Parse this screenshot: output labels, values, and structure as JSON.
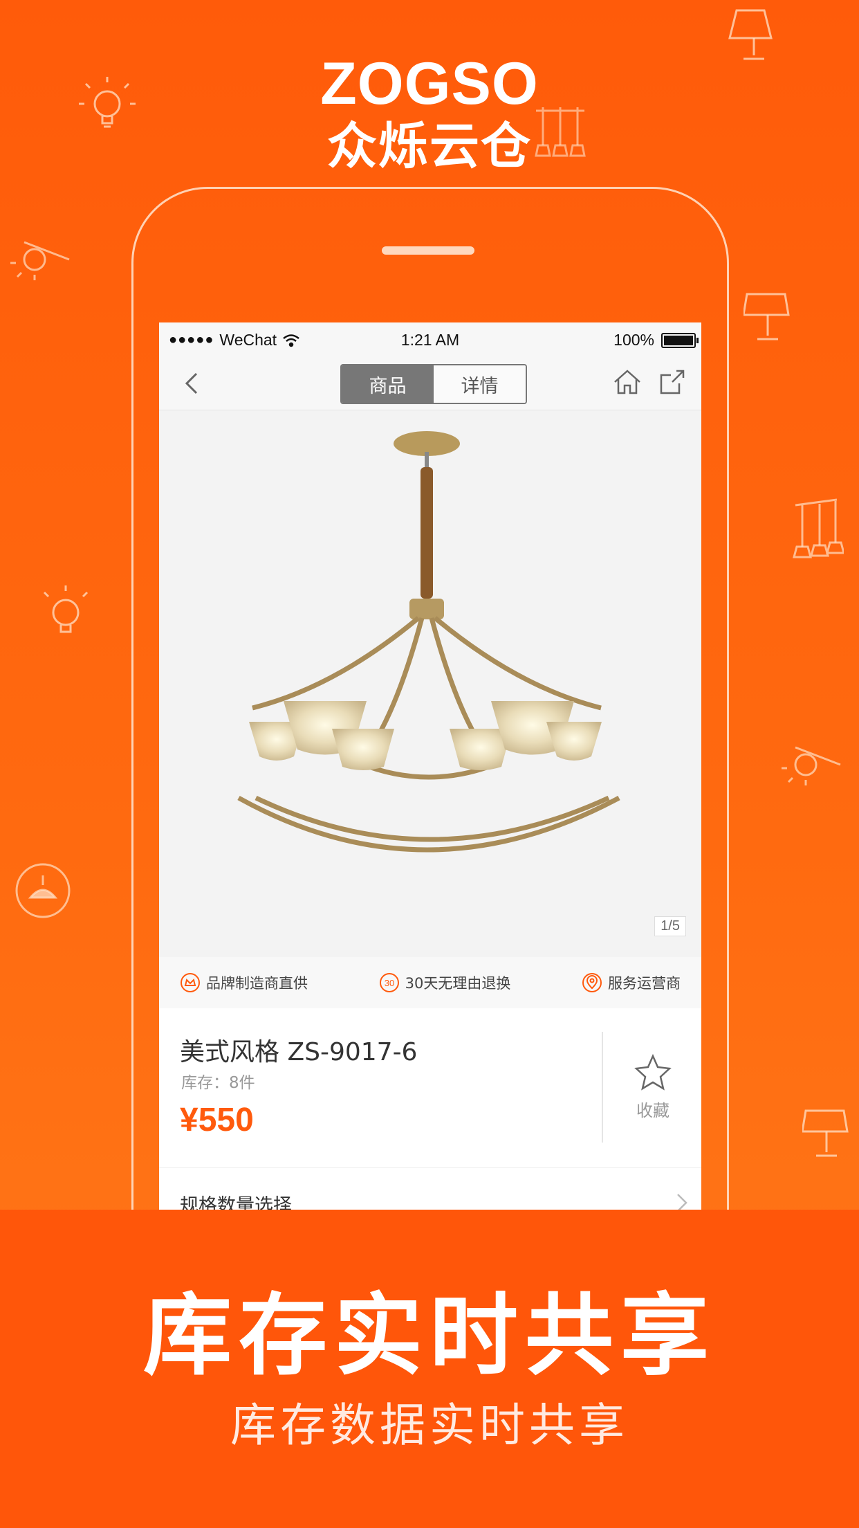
{
  "brand": {
    "name_en": "ZOGSO",
    "name_cn": "众烁云仓"
  },
  "status_bar": {
    "carrier": "WeChat",
    "time": "1:21 AM",
    "battery": "100%"
  },
  "nav": {
    "tabs": [
      {
        "label": "商品",
        "active": true
      },
      {
        "label": "详情",
        "active": false
      }
    ]
  },
  "product": {
    "image_pager": "1/5",
    "badges": [
      {
        "icon": "crown-icon",
        "label": "品牌制造商直供"
      },
      {
        "icon": "return-30-icon",
        "label": "30天无理由退换",
        "icon_text": "30"
      },
      {
        "icon": "location-pin-icon",
        "label": "服务运营商"
      }
    ],
    "title": "美式风格 ZS-9017-6",
    "stock": "库存：8件",
    "price": "¥550",
    "favorite_label": "收藏",
    "spec_label": "规格数量选择"
  },
  "promo": {
    "headline": "库存实时共享",
    "subheadline": "库存数据实时共享"
  },
  "colors": {
    "accent": "#ff5a0d",
    "background": "#ff6a10"
  }
}
